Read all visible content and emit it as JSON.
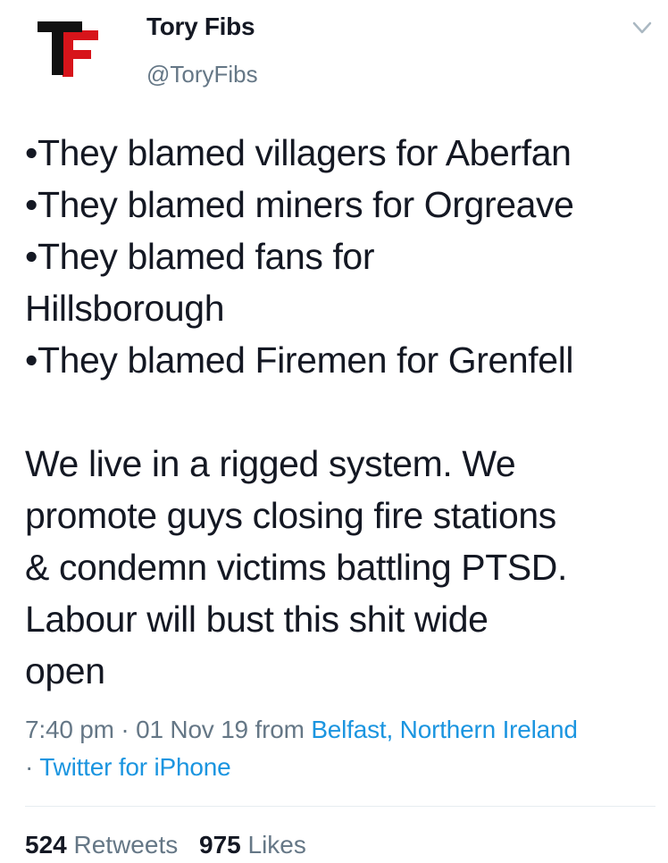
{
  "author": {
    "avatar_letters": "TF",
    "display_name": "Tory Fibs",
    "handle": "@ToryFibs"
  },
  "tweet": {
    "lines": [
      "•They blamed villagers for Aberfan",
      "•They blamed miners for Orgreave",
      "•They blamed fans for",
      "Hillsborough",
      "•They blamed Firemen for Grenfell",
      "",
      "We live in a rigged system. We",
      "promote guys closing fire stations",
      "& condemn victims battling PTSD.",
      "Labour will bust this shit wide",
      "open"
    ],
    "time": "7:40 pm",
    "date": "01 Nov 19",
    "from_label": "from",
    "location": "Belfast, Northern Ireland",
    "client": "Twitter for iPhone"
  },
  "stats": {
    "retweets_count": "524",
    "retweets_label": "Retweets",
    "likes_count": "975",
    "likes_label": "Likes"
  },
  "colors": {
    "text": "#141823",
    "secondary": "#657786",
    "link": "#1b95e0",
    "logo_black": "#111111",
    "logo_red": "#d7141a"
  },
  "icons": {
    "caret": "chevron-down-icon",
    "avatar": "tory-fibs-logo"
  }
}
